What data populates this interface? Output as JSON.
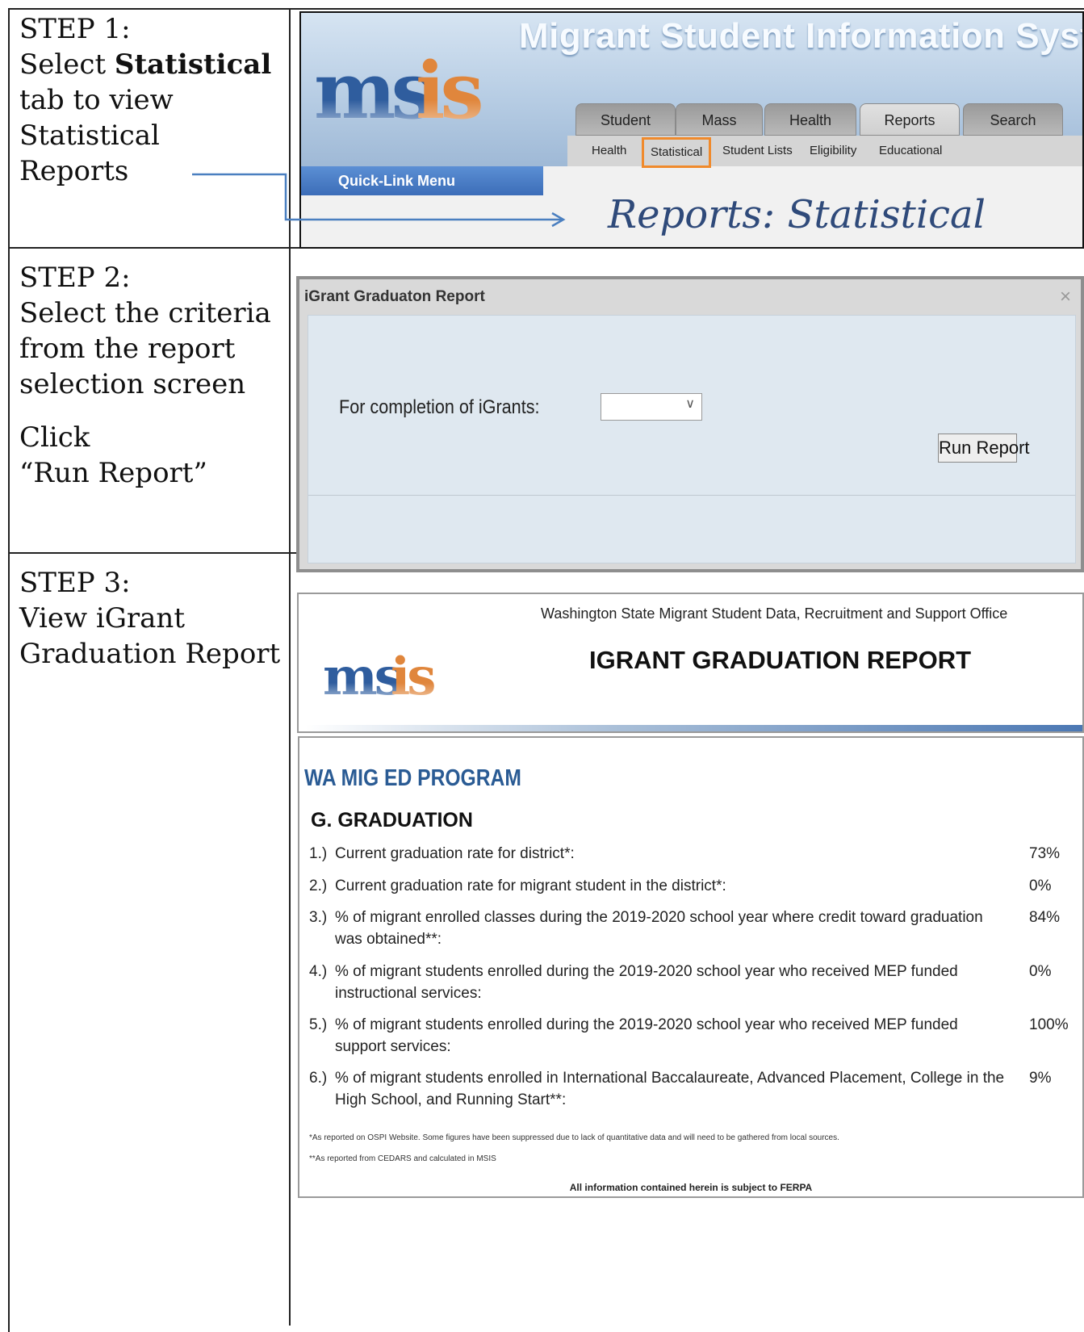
{
  "steps": [
    {
      "heading": "STEP 1:",
      "line1_pre": "Select ",
      "line1_bold": "Statistical",
      "line2": "tab to view",
      "line3": "Statistical",
      "line4": "Reports"
    },
    {
      "heading": "STEP 2:",
      "line1": "Select the criteria",
      "line2": "from the report",
      "line3": "selection screen",
      "line4": "Click",
      "line5": "“Run Report”"
    },
    {
      "heading": "STEP 3:",
      "line1": "View iGrant",
      "line2": "Graduation Report"
    }
  ],
  "step1_screen": {
    "system_title": "Migrant Student Information System",
    "logo_text": "msis",
    "tabs": [
      "Student",
      "Mass",
      "Health",
      "Reports",
      "Search"
    ],
    "active_tab": "Reports",
    "subnav": [
      "Health",
      "Statistical",
      "Student Lists",
      "Eligibility",
      "Educational"
    ],
    "highlighted_subnav": "Statistical",
    "quick_link": "Quick-Link Menu",
    "page_heading": "Reports: Statistical"
  },
  "step2_screen": {
    "dialog_title": "iGrant Graduaton Report",
    "close_glyph": "×",
    "field_label": "For completion of iGrants:",
    "select_value": "",
    "select_caret": "∨",
    "run_button": "Run Report"
  },
  "step3_report": {
    "org": "Washington State Migrant Student Data, Recruitment and Support Office",
    "title": "IGRANT GRADUATION REPORT",
    "logo_text": "msis",
    "program": "WA MIG ED PROGRAM",
    "section": "G. GRADUATION",
    "items": [
      {
        "num": "1.)",
        "text": "Current graduation rate for district*:",
        "value": "73%"
      },
      {
        "num": "2.)",
        "text": "Current graduation rate for migrant student in the district*:",
        "value": "0%"
      },
      {
        "num": "3.)",
        "text": "% of migrant enrolled classes during the 2019-2020 school year where credit toward graduation was obtained**:",
        "value": "84%"
      },
      {
        "num": "4.)",
        "text": "% of migrant students enrolled during the 2019-2020 school year who received MEP funded instructional services:",
        "value": "0%"
      },
      {
        "num": "5.)",
        "text": "% of migrant students enrolled during the 2019-2020 school year who received MEP funded support services:",
        "value": "100%"
      },
      {
        "num": "6.)",
        "text": "% of migrant students enrolled in International Baccalaureate, Advanced Placement, College in the High School, and Running Start**:",
        "value": "9%"
      }
    ],
    "note1": "*As reported on OSPI Website. Some figures have been suppressed due to lack of quantitative data and will need to be gathered from local sources.",
    "note2": "**As reported from CEDARS and calculated in MSIS",
    "ferpa": "All information contained herein is subject to FERPA"
  },
  "colors": {
    "highlight": "#f08a2c",
    "brand_blue": "#2a5b94",
    "arrow": "#4a7fc0"
  }
}
